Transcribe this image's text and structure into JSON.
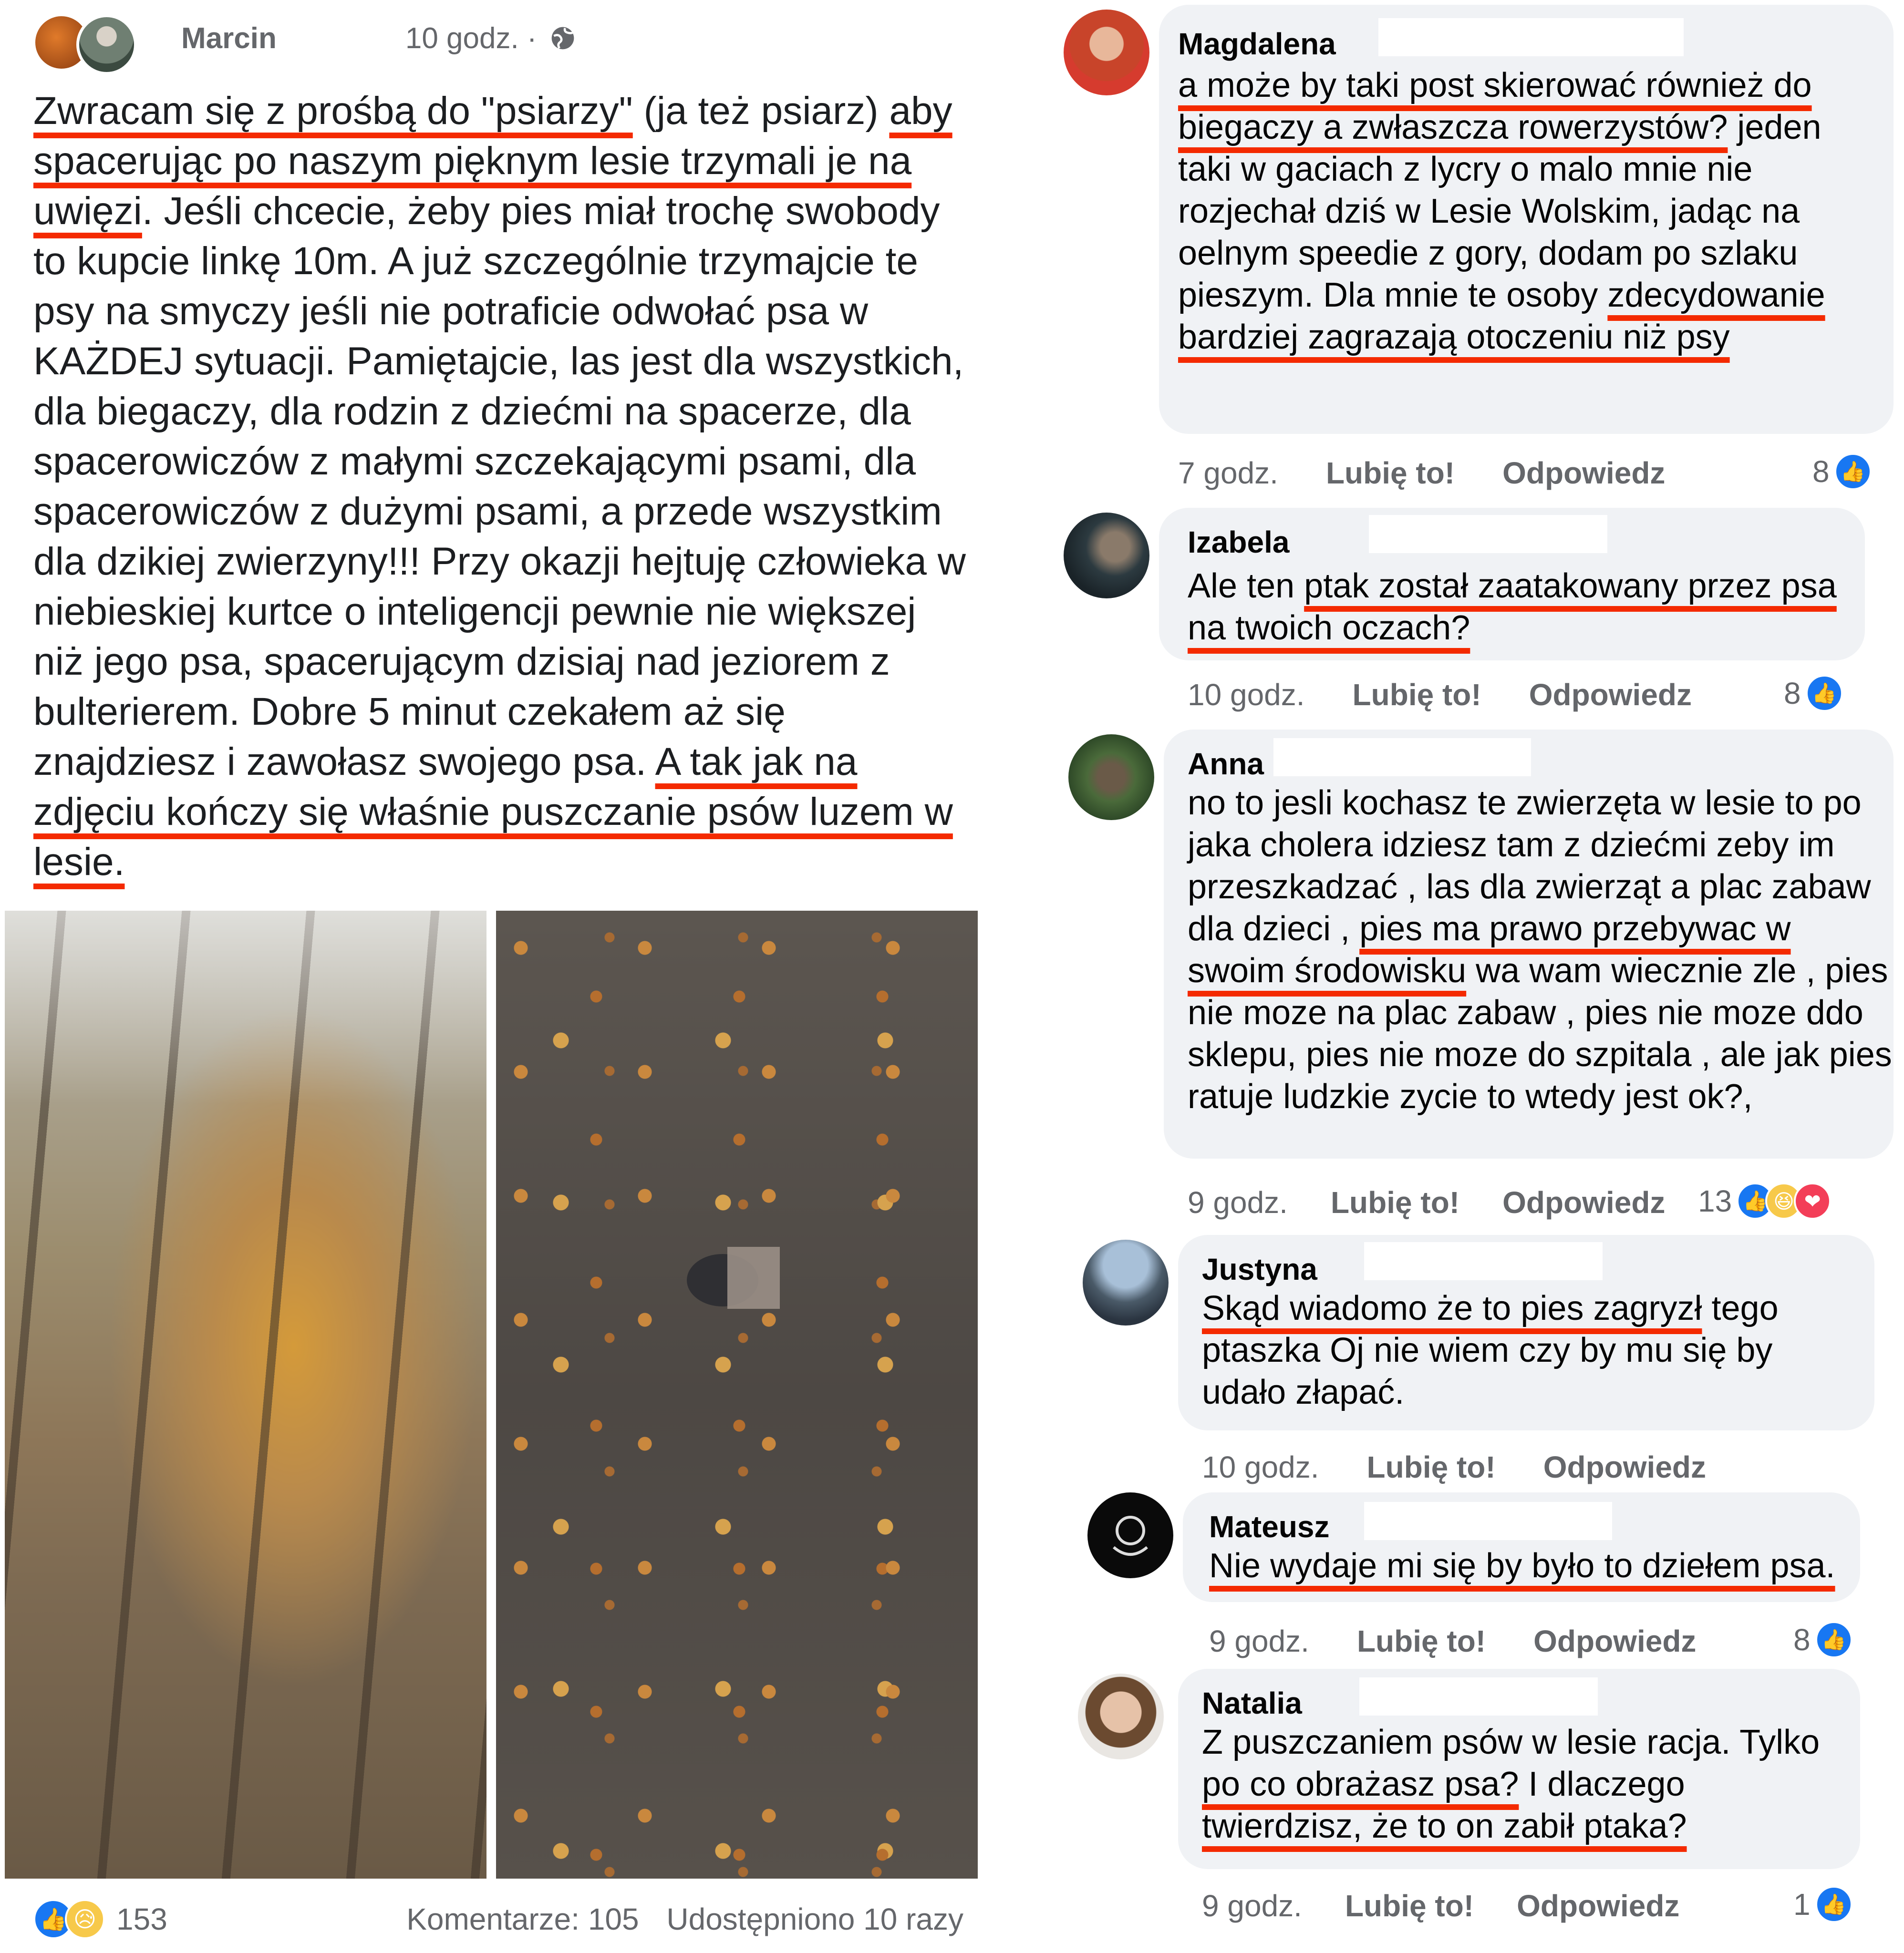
{
  "post": {
    "author": "Marcin",
    "time": "10 godz. ·",
    "body": {
      "p1_u": "Zwracam się z prośbą do \"psiarzy\"",
      "p1_n": " (ja też psiarz) ",
      "p2_u": "aby spacerując po naszym pięknym lesie trzymali je na uwięzi",
      "p3_n": ". Jeśli chcecie, żeby pies miał trochę swobody to kupcie linkę 10m. A już szczególnie trzymajcie te psy na smyczy jeśli nie potraficie odwołać psa w KAŻDEJ sytuacji. Pamiętajcie, las jest dla wszystkich, dla biegaczy, dla rodzin z dziećmi na spacerze, dla spacerowiczów z małymi szczekającymi psami, dla spacerowiczów z dużymi psami, a przede wszystkim dla dzikiej zwierzyny!!! Przy okazji hejtuję człowieka w niebieskiej kurtce o inteligencji pewnie nie większej niż jego psa, spacerującym dzisiaj nad jeziorem z bulterierem. Dobre 5 minut czekałem aż się znajdziesz i zawołasz swojego psa. ",
      "p4_u": "A tak jak na zdjęciu kończy się właśnie puszczanie psów luzem w lesie."
    },
    "reactions_count": "153",
    "comments_count": "Komentarze: 105",
    "shares_count": "Udostępniono 10 razy",
    "like_color": "#1877f2",
    "underline_color": "#f42a00"
  },
  "comments": [
    {
      "name": "Magdalena",
      "text_u1": "a może by taki post skierować również do biegaczy a zwłaszcza rowerzystów?",
      "text_n": " jeden taki w gaciach z lycry o malo mnie nie rozjechał dziś w Lesie Wolskim, jadąc na oelnym speedie z gory, dodam po szlaku pieszym. Dla mnie te osoby ",
      "text_u2": "zdecydowanie bardziej zagrazają otoczeniu niż psy",
      "time": "7 godz.",
      "like": "Lubię to!",
      "reply": "Odpowiedz",
      "reactions": "8"
    },
    {
      "name": "Izabela",
      "text_n": "Ale ten ",
      "text_u1": "ptak został zaatakowany przez psa na twoich oczach?",
      "time": "10 godz.",
      "like": "Lubię to!",
      "reply": "Odpowiedz",
      "reactions": "8"
    },
    {
      "name": "Anna",
      "text_n": "no to jesli kochasz te zwierzęta w lesie to po jaka cholera idziesz tam z dziećmi zeby im przeszkadzać , las dla zwierząt a plac zabaw dla dzieci , ",
      "text_u1": "pies ma prawo przebywac w swoim środowisku",
      "text_n2": " wa wam wiecznie zle , pies nie moze na plac zabaw , pies nie moze ddo sklepu, pies nie moze do szpitala , ale jak pies ratuje ludzkie zycie to wtedy jest ok?,",
      "time": "9 godz.",
      "like": "Lubię to!",
      "reply": "Odpowiedz",
      "reactions": "13"
    },
    {
      "name": "Justyna",
      "text_u1": "Skąd wiadomo że to pies zagryzł",
      "text_n": " tego ptaszka Oj nie wiem czy by mu się by udało złapać.",
      "time": "10 godz.",
      "like": "Lubię to!",
      "reply": "Odpowiedz"
    },
    {
      "name": "Mateusz",
      "text_u1": "Nie wydaje mi się by było to dziełem psa.",
      "time": "9 godz.",
      "like": "Lubię to!",
      "reply": "Odpowiedz",
      "reactions": "8"
    },
    {
      "name": "Natalia",
      "text_n": "Z puszczaniem psów w lesie racja. Tylko ",
      "text_u1": "po co obrażasz psa?",
      "text_n2": " I dlaczego ",
      "text_u2": "twierdzisz, że to on zabił ptaka?",
      "time": "9 godz.",
      "like": "Lubię to!",
      "reply": "Odpowiedz",
      "reactions": "1"
    }
  ],
  "icons": {
    "like": "like-thumb-icon",
    "sad": "sad-face-icon",
    "haha": "haha-face-icon",
    "love": "heart-icon",
    "globe": "globe-icon"
  }
}
